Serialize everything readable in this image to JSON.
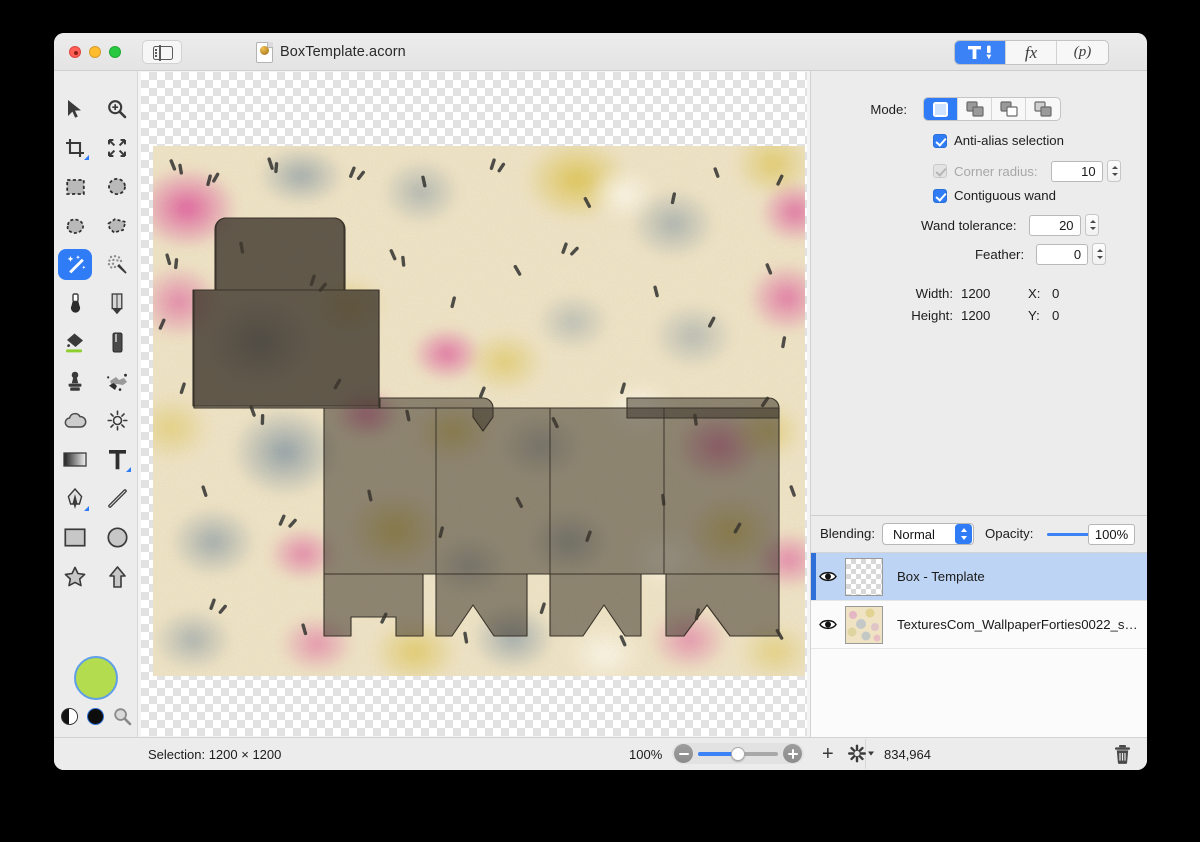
{
  "window": {
    "title": "BoxTemplate.acorn",
    "traffic_lights": [
      "close",
      "minimize",
      "zoom"
    ],
    "sidebar_toggle_icon": "sidebar-icon",
    "doc_icon": "acorn-document-icon",
    "mode_segments": [
      {
        "name": "tools",
        "icon": "hammer-tool-icon",
        "selected": true
      },
      {
        "name": "filters",
        "label": "fx",
        "selected": false
      },
      {
        "name": "presets",
        "label": "(p)",
        "selected": false
      }
    ]
  },
  "tools": {
    "items": [
      {
        "name": "move-tool",
        "icon": "arrow-cursor-icon",
        "selected": false
      },
      {
        "name": "zoom-tool",
        "icon": "magnifier-plus-icon",
        "selected": false
      },
      {
        "name": "crop-tool",
        "icon": "crop-icon",
        "selected": false,
        "has_options": true
      },
      {
        "name": "transform-tool",
        "icon": "arrows-expand-icon",
        "selected": false
      },
      {
        "name": "rect-select-tool",
        "icon": "rectangle-marquee-icon",
        "selected": false
      },
      {
        "name": "ellipse-select-tool",
        "icon": "ellipse-marquee-icon",
        "selected": false
      },
      {
        "name": "lasso-tool",
        "icon": "lasso-icon",
        "selected": false
      },
      {
        "name": "polygon-lasso-tool",
        "icon": "polygon-lasso-icon",
        "selected": false
      },
      {
        "name": "magic-wand-tool",
        "icon": "magic-wand-icon",
        "selected": true
      },
      {
        "name": "instant-alpha-tool",
        "icon": "dotted-wand-icon",
        "selected": false
      },
      {
        "name": "brush-tool",
        "icon": "brush-icon",
        "selected": false
      },
      {
        "name": "pencil-tool",
        "icon": "pencil-icon",
        "selected": false
      },
      {
        "name": "paint-bucket-tool",
        "icon": "paint-bucket-icon",
        "selected": false
      },
      {
        "name": "eraser-tool",
        "icon": "eraser-icon",
        "selected": false
      },
      {
        "name": "clone-stamp-tool",
        "icon": "stamp-icon",
        "selected": false
      },
      {
        "name": "smudge-tool",
        "icon": "splatter-icon",
        "selected": false
      },
      {
        "name": "blur-tool",
        "icon": "cloud-icon",
        "selected": false
      },
      {
        "name": "dodge-tool",
        "icon": "sun-icon",
        "selected": false
      },
      {
        "name": "gradient-tool",
        "icon": "gradient-icon",
        "selected": false
      },
      {
        "name": "text-tool",
        "icon": "text-t-icon",
        "selected": false,
        "has_options": true
      },
      {
        "name": "bezier-pen-tool",
        "icon": "pen-nib-icon",
        "selected": false,
        "has_options": true
      },
      {
        "name": "line-tool",
        "icon": "line-icon",
        "selected": false
      },
      {
        "name": "rectangle-shape-tool",
        "icon": "rectangle-icon",
        "selected": false
      },
      {
        "name": "ellipse-shape-tool",
        "icon": "circle-icon",
        "selected": false
      },
      {
        "name": "star-shape-tool",
        "icon": "star-icon",
        "selected": false
      },
      {
        "name": "arrow-shape-tool",
        "icon": "up-arrow-icon",
        "selected": false
      }
    ],
    "colors": {
      "foreground": "#b3dc4e",
      "foreground_ring": "#5f9ee8",
      "background": "#0d0d0d",
      "swap_icon": "swap-colors-icon",
      "picker_icon": "color-picker-magnifier-icon"
    }
  },
  "inspector": {
    "mode": {
      "label": "Mode:",
      "options": [
        {
          "name": "new-selection",
          "icon": "new-selection-icon",
          "selected": true
        },
        {
          "name": "add-to-selection",
          "icon": "add-selection-icon",
          "selected": false
        },
        {
          "name": "subtract-from-selection",
          "icon": "subtract-selection-icon",
          "selected": false
        },
        {
          "name": "intersect-selection",
          "icon": "intersect-selection-icon",
          "selected": false
        }
      ]
    },
    "anti_alias": {
      "label": "Anti-alias selection",
      "checked": true,
      "enabled": true
    },
    "corner_radius": {
      "label": "Corner radius:",
      "checked": true,
      "enabled": false,
      "value": "10"
    },
    "contiguous_wand": {
      "label": "Contiguous wand",
      "checked": true,
      "enabled": true
    },
    "wand_tolerance": {
      "label": "Wand tolerance:",
      "value": "20"
    },
    "feather": {
      "label": "Feather:",
      "value": "0"
    },
    "dimensions": {
      "width_label": "Width:",
      "width_value": "1200",
      "height_label": "Height:",
      "height_value": "1200",
      "x_label": "X:",
      "x_value": "0",
      "y_label": "Y:",
      "y_value": "0"
    }
  },
  "layers_panel": {
    "blending_label": "Blending:",
    "blending_value": "Normal",
    "opacity_label": "Opacity:",
    "opacity_value": "100%",
    "opacity_percent": 100,
    "rows": [
      {
        "name": "Box - Template",
        "visible": true,
        "selected": true,
        "thumb": "transparent-checker"
      },
      {
        "name": "TexturesCom_WallpaperForties0022_s…",
        "visible": true,
        "selected": false,
        "thumb": "floral-wallpaper"
      }
    ]
  },
  "statusbar": {
    "selection_text": "Selection: 1200 × 1200",
    "zoom_level": "100%",
    "zoom_slider_percent": 50,
    "zoom_out_icon": "minus-circle-icon",
    "zoom_in_icon": "plus-circle-icon",
    "add_layer_icon": "plus-icon",
    "actions_icon": "gear-icon",
    "pixel_count": "834,964",
    "delete_layer_icon": "trash-icon"
  },
  "canvas": {
    "artboard_name": "box-template-artboard",
    "overlay_fill": "rgba(60,52,42,0.55)",
    "overlay_stroke": "#3a352e"
  }
}
